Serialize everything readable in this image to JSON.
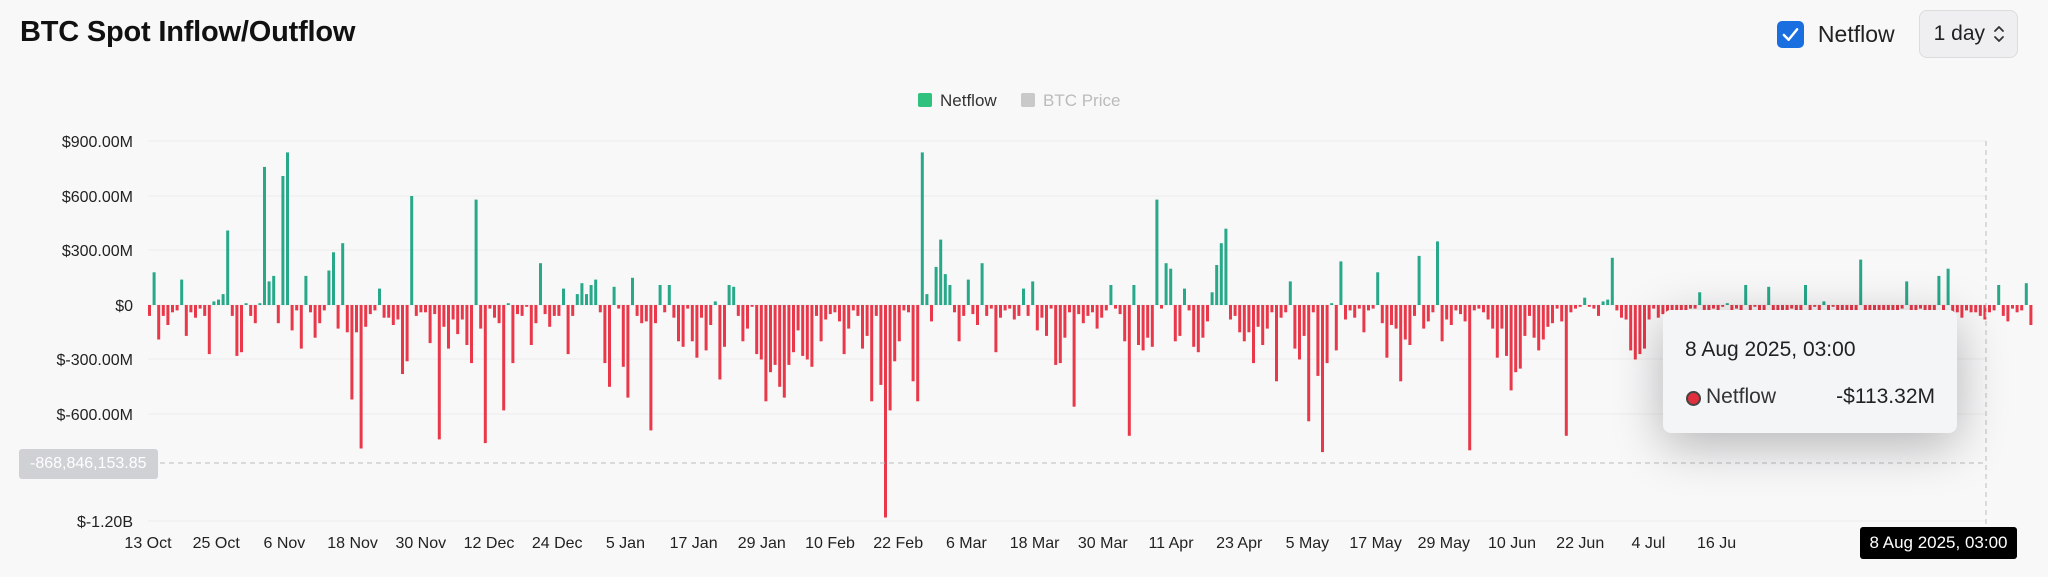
{
  "header": {
    "title": "BTC Spot Inflow/Outflow"
  },
  "controls": {
    "netflow_label": "Netflow",
    "netflow_checked": true,
    "interval": "1 day"
  },
  "colors": {
    "positive": "#26a889",
    "negative": "#e8384a",
    "legend_netflow": "#2ec27e",
    "legend_price": "#c9c9c9",
    "grid": "#ececec"
  },
  "chart_data": {
    "type": "bar",
    "title": "BTC Spot Inflow/Outflow",
    "legend": [
      {
        "name": "Netflow",
        "active": true
      },
      {
        "name": "BTC Price",
        "active": false
      }
    ],
    "legend_position": "top-center",
    "grid": true,
    "y_ticks": [
      "$900.00M",
      "$600.00M",
      "$300.00M",
      "$0",
      "$-300.00M",
      "$-600.00M",
      "$-1.20B"
    ],
    "ylim": [
      -1200,
      900
    ],
    "y_unit": "$M",
    "x_ticks": [
      "13 Oct",
      "25 Oct",
      "6 Nov",
      "18 Nov",
      "30 Nov",
      "12 Dec",
      "24 Dec",
      "5 Jan",
      "17 Jan",
      "29 Jan",
      "10 Feb",
      "22 Feb",
      "6 Mar",
      "18 Mar",
      "30 Mar",
      "11 Apr",
      "23 Apr",
      "5 May",
      "17 May",
      "29 May",
      "10 Jun",
      "22 Jun",
      "4 Jul",
      "16 Ju"
    ],
    "x_range": [
      "2024-10-13",
      "2025-08-08"
    ],
    "series": [
      {
        "name": "Netflow",
        "start_date": "2024-10-12",
        "values": [
          -60,
          180,
          -190,
          -60,
          -110,
          -40,
          -30,
          140,
          -170,
          -40,
          -70,
          -20,
          -60,
          -270,
          20,
          30,
          60,
          410,
          -60,
          -280,
          -260,
          10,
          -60,
          -100,
          10,
          760,
          130,
          160,
          -100,
          710,
          840,
          -140,
          -30,
          -240,
          160,
          -40,
          -180,
          -100,
          -30,
          190,
          290,
          -130,
          340,
          -150,
          -520,
          -150,
          -790,
          -120,
          -50,
          -30,
          90,
          -70,
          -70,
          -110,
          -80,
          -380,
          -310,
          600,
          -60,
          -40,
          -40,
          -210,
          -50,
          -740,
          -120,
          -240,
          -80,
          -160,
          -80,
          -220,
          -320,
          580,
          -130,
          -760,
          -20,
          -70,
          -100,
          -580,
          10,
          -320,
          -50,
          -60,
          -10,
          -220,
          -100,
          230,
          -50,
          -120,
          -60,
          -60,
          90,
          -270,
          -60,
          60,
          120,
          60,
          110,
          140,
          -40,
          -320,
          -450,
          100,
          -20,
          -340,
          -510,
          150,
          -60,
          -100,
          -90,
          -690,
          -100,
          110,
          -40,
          110,
          -70,
          -200,
          -230,
          -20,
          -200,
          -290,
          -70,
          -250,
          -110,
          20,
          -410,
          -230,
          110,
          100,
          -60,
          -200,
          -130,
          -10,
          -270,
          -300,
          -530,
          -370,
          -330,
          -450,
          -510,
          -330,
          -260,
          -140,
          -280,
          -300,
          -340,
          -60,
          -200,
          -80,
          -50,
          -40,
          -90,
          -270,
          -130,
          -30,
          -60,
          -240,
          -170,
          -530,
          -60,
          -440,
          -1170,
          -580,
          -310,
          -200,
          -30,
          -40,
          -420,
          -530,
          840,
          60,
          -90,
          210,
          360,
          170,
          110,
          -40,
          -200,
          -60,
          140,
          -50,
          -110,
          230,
          -60,
          -20,
          -260,
          -70,
          -30,
          -20,
          -80,
          -60,
          90,
          -60,
          130,
          -140,
          -70,
          -170,
          -20,
          -330,
          -320,
          -180,
          -40,
          -560,
          -50,
          -100,
          -60,
          -40,
          -130,
          -70,
          -30,
          110,
          -20,
          -50,
          -200,
          -720,
          110,
          -220,
          -250,
          -180,
          -230,
          580,
          -20,
          230,
          200,
          -200,
          -170,
          90,
          -30,
          -230,
          -260,
          -180,
          -90,
          70,
          220,
          340,
          420,
          -80,
          -60,
          -150,
          -200,
          -150,
          -320,
          -120,
          -220,
          -130,
          -40,
          -420,
          -70,
          -40,
          130,
          -240,
          -300,
          -170,
          -640,
          -40,
          -390,
          -810,
          -320,
          10,
          -250,
          240,
          -80,
          -30,
          -70,
          -20,
          -150,
          -30,
          -20,
          180,
          -100,
          -290,
          -110,
          -130,
          -420,
          -190,
          -220,
          -60,
          270,
          -130,
          -90,
          -40,
          350,
          -200,
          -80,
          -110,
          -30,
          -50,
          -90,
          -800,
          -30,
          -20,
          -40,
          -80,
          -130,
          -290,
          -130,
          -280,
          -470,
          -370,
          -350,
          -170,
          -60,
          -180,
          -250,
          -190,
          -120,
          -100,
          -20,
          -90,
          -720,
          -40,
          -20,
          -10,
          40,
          -10,
          -20,
          -60,
          20,
          30,
          260,
          -30,
          -70,
          -80,
          -250,
          -300,
          -270,
          -240,
          -80,
          -20,
          -70,
          -50,
          -70,
          -40,
          -80,
          -30,
          -30,
          -20,
          -20,
          70,
          -30,
          -40,
          -20,
          -30,
          -10,
          10,
          -40,
          -20,
          -30,
          110,
          -40,
          -10,
          -30,
          -40,
          100,
          -40,
          -50,
          -70,
          -30,
          -20,
          -40,
          -50,
          110,
          -40,
          -10,
          -60,
          20,
          -30,
          -10,
          -60,
          -40,
          -30,
          -50,
          -30,
          250,
          -40,
          -30,
          -40,
          -60,
          -50,
          -70,
          -30,
          -40,
          -20,
          130,
          -80,
          -30,
          -20,
          -70,
          -40,
          -60,
          160,
          -90,
          200,
          -60,
          -40,
          -70,
          -30,
          -40,
          -40,
          -60,
          -80,
          -40,
          -30,
          110,
          -60,
          -90,
          -20,
          -40,
          -30,
          120,
          -110
        ]
      }
    ],
    "hover": {
      "date": "8 Aug 2025, 03:00",
      "series": "Netflow",
      "value": "-$113.32M",
      "y_readout": "-868,846,153.85"
    }
  }
}
